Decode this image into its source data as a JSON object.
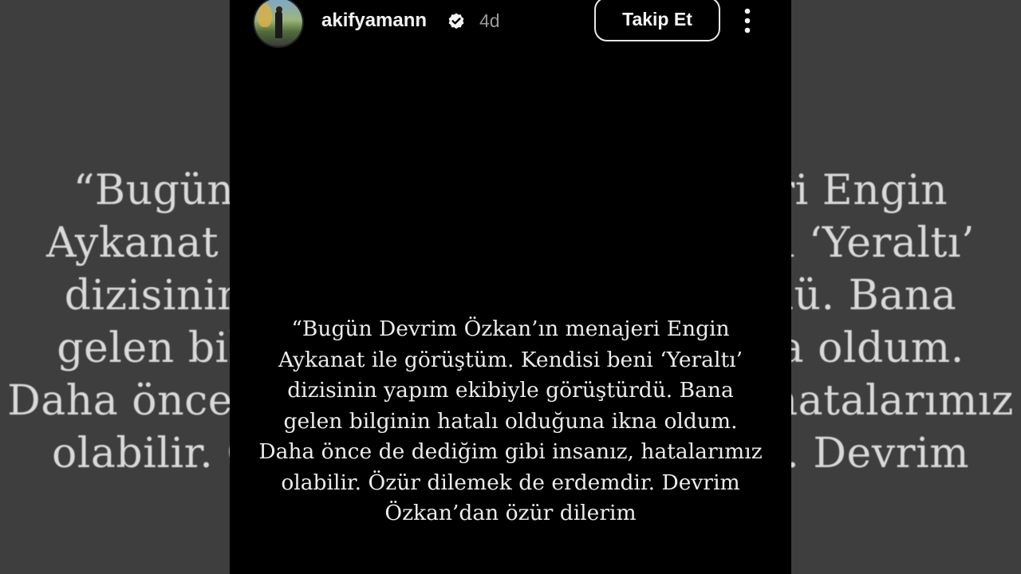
{
  "story": {
    "username": "akifyamann",
    "time_ago": "4d",
    "follow_label": "Takip Et",
    "verified_icon": "verified-badge-icon",
    "more_icon": "more-vertical-icon",
    "quote_text": "“Bugün Devrim Özkan’ın menajeri Engin\nAykanat ile görüştüm. Kendisi beni ‘Yeraltı’\ndizisinin yapım ekibiyle görüştürdü. Bana\ngelen bilginin hatalı olduğuna ikna oldum.\nDaha önce de dediğim gibi insanız, hatalarımız\nolabilir. Özür dilemek de erdemdir. Devrim\nÖzkan’dan özür dilerim"
  },
  "colors": {
    "story_background": "#000000",
    "side_background": "#3e3e3e",
    "text": "#ececec",
    "muted_text": "#9a9a9a"
  }
}
